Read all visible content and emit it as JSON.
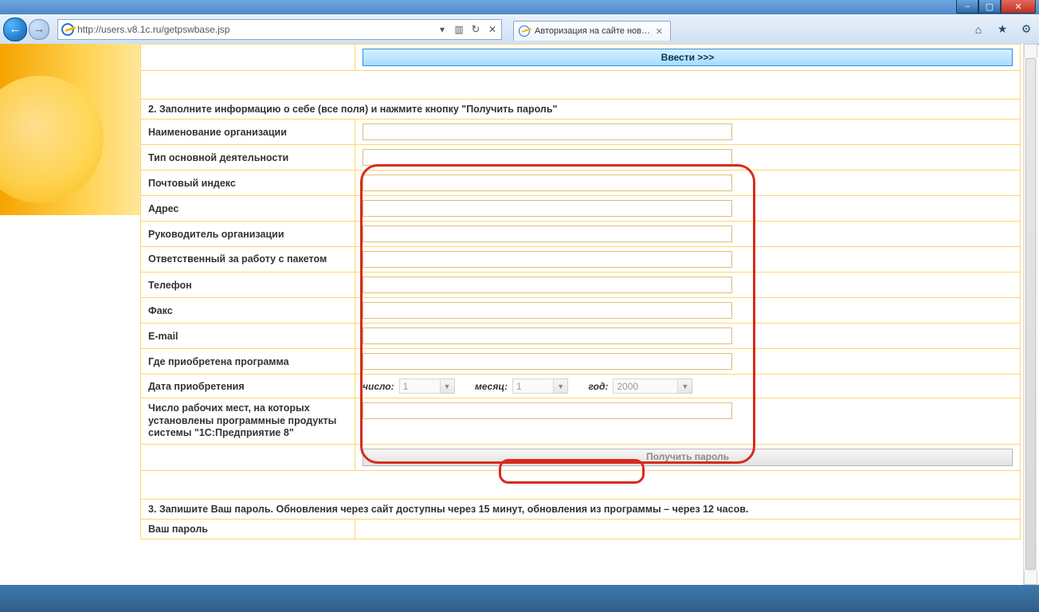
{
  "browser": {
    "url": "http://users.v8.1c.ru/getpswbase.jsp",
    "tabTitle": "Авторизация на сайте нов…",
    "tools": {
      "home": "⌂",
      "star": "★",
      "gear": "⚙"
    }
  },
  "topButton": {
    "enter": "Ввести >>>"
  },
  "section2": {
    "heading": "2. Заполните информацию о себе (все поля) и нажмите кнопку \"Получить пароль\"",
    "fields": {
      "org": "Наименование организации",
      "activity": "Тип основной деятельности",
      "zip": "Почтовый индекс",
      "address": "Адрес",
      "head": "Руководитель организации",
      "responsible": "Ответственный за работу с пакетом",
      "phone": "Телефон",
      "fax": "Факс",
      "email": "E-mail",
      "boughtWhere": "Где приобретена программа",
      "purchaseDate": "Дата приобретения",
      "seats": "Число рабочих мест, на которых установлены программные продукты системы \"1С:Предприятие 8\""
    },
    "date": {
      "dayLabel": "число:",
      "day": "1",
      "monLabel": "месяц:",
      "mon": "1",
      "yearLabel": "год:",
      "year": "2000"
    },
    "submit": "Получить пароль"
  },
  "section3": {
    "heading": "3. Запишите Ваш пароль. Обновления через сайт доступны через 15 минут, обновления из программы – через 12 часов.",
    "pwdLabel": "Ваш пароль"
  }
}
